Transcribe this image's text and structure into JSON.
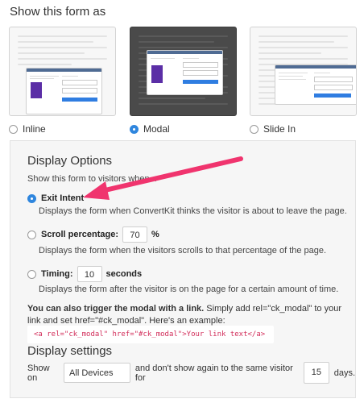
{
  "section_title": "Show this form as",
  "form_types": [
    {
      "label": "Inline",
      "selected": false
    },
    {
      "label": "Modal",
      "selected": true
    },
    {
      "label": "Slide In",
      "selected": false
    }
  ],
  "display_options": {
    "title": "Display Options",
    "subtitle": "Show this form to visitors when...",
    "exit_intent": {
      "label": "Exit Intent",
      "selected": true,
      "description": "Displays the form when ConvertKit thinks the visitor is about to leave the page."
    },
    "scroll": {
      "label": "Scroll percentage:",
      "value": "70",
      "unit": "%",
      "selected": false,
      "description": "Displays the form when the visitors scrolls to that percentage of the page."
    },
    "timing": {
      "label": "Timing:",
      "value": "10",
      "unit": "seconds",
      "selected": false,
      "description": "Displays the form after the visitor is on the page for a certain amount of time."
    },
    "trigger_bold": "You can also trigger the modal with a link.",
    "trigger_text": " Simply add rel=\"ck_modal\" to your link and set href=\"#ck_modal\". Here's an example:",
    "code_example": "<a rel=\"ck_modal\" href=\"#ck_modal\">Your link text</a>"
  },
  "display_settings": {
    "title": "Display settings",
    "show_on_label": "Show on",
    "device_value": "All Devices",
    "middle_text": "and don't show again to the same visitor for",
    "days_value": "15",
    "days_label": "days."
  },
  "colors": {
    "accent": "#2f86de",
    "arrow": "#f0346e",
    "modal_preview_bg": "#4a4a4a"
  }
}
